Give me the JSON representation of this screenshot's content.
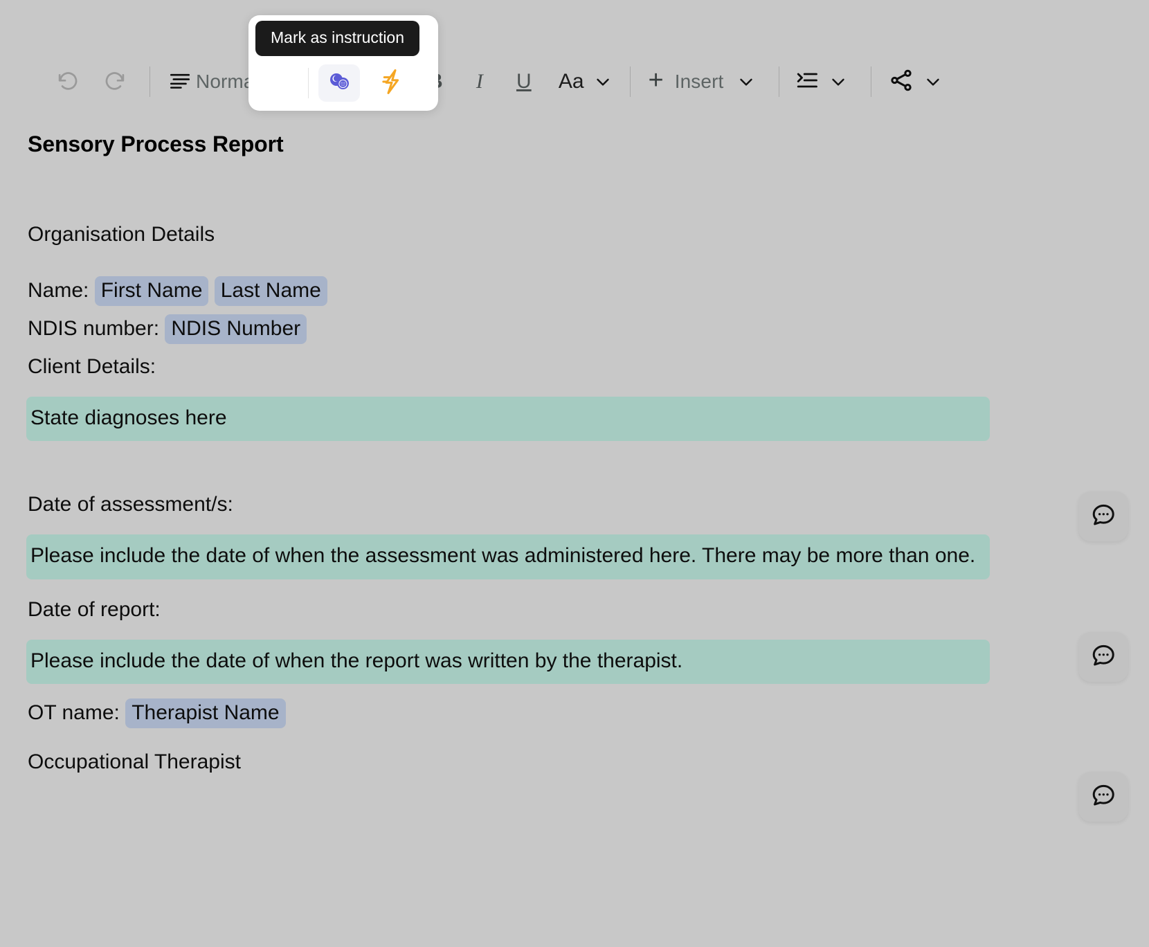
{
  "toolbar": {
    "undo_label": "undo-icon",
    "redo_label": "redo-icon",
    "paragraph_style": "Normal",
    "bold_label": "B",
    "italic_label": "I",
    "underline_label": "U",
    "font_label": "Aa",
    "insert_plus": "+",
    "insert_label": "Insert",
    "indent_label": "indent-icon",
    "share_label": "share-icon"
  },
  "popup": {
    "tooltip": "Mark as instruction",
    "instruction_icon": "instruction-circles-icon",
    "lightning_icon": "lightning-bolt-icon"
  },
  "document": {
    "title": "Sensory Process Report",
    "section_heading": "Organisation Details",
    "name_label": "Name:",
    "first_name_chip": "First Name",
    "last_name_chip": "Last Name",
    "ndis_label": "NDIS number:",
    "ndis_chip": "NDIS Number",
    "client_details_label": "Client Details:",
    "diagnoses_highlight": "State diagnoses here",
    "assessment_date_label": "Date of assessment/s:",
    "assessment_date_highlight": "Please include the date of when the assessment was administered here. There may be more than one.",
    "report_date_label": "Date of report:",
    "report_date_highlight": "Please include the date of when the report was written by the therapist.",
    "ot_name_label": "OT name:",
    "therapist_chip": "Therapist Name",
    "occupation_line": "Occupational Therapist"
  },
  "comments": {
    "bubble_icon": "comment-bubble-icon",
    "count": 3
  },
  "colors": {
    "page_background": "#c8c8c8",
    "chip_background": "#a7b3c9",
    "highlight_background": "#a5cbc1",
    "tooltip_background": "#1b1b1b",
    "accent_purple": "#5b5bd6",
    "accent_orange": "#f5a623"
  }
}
